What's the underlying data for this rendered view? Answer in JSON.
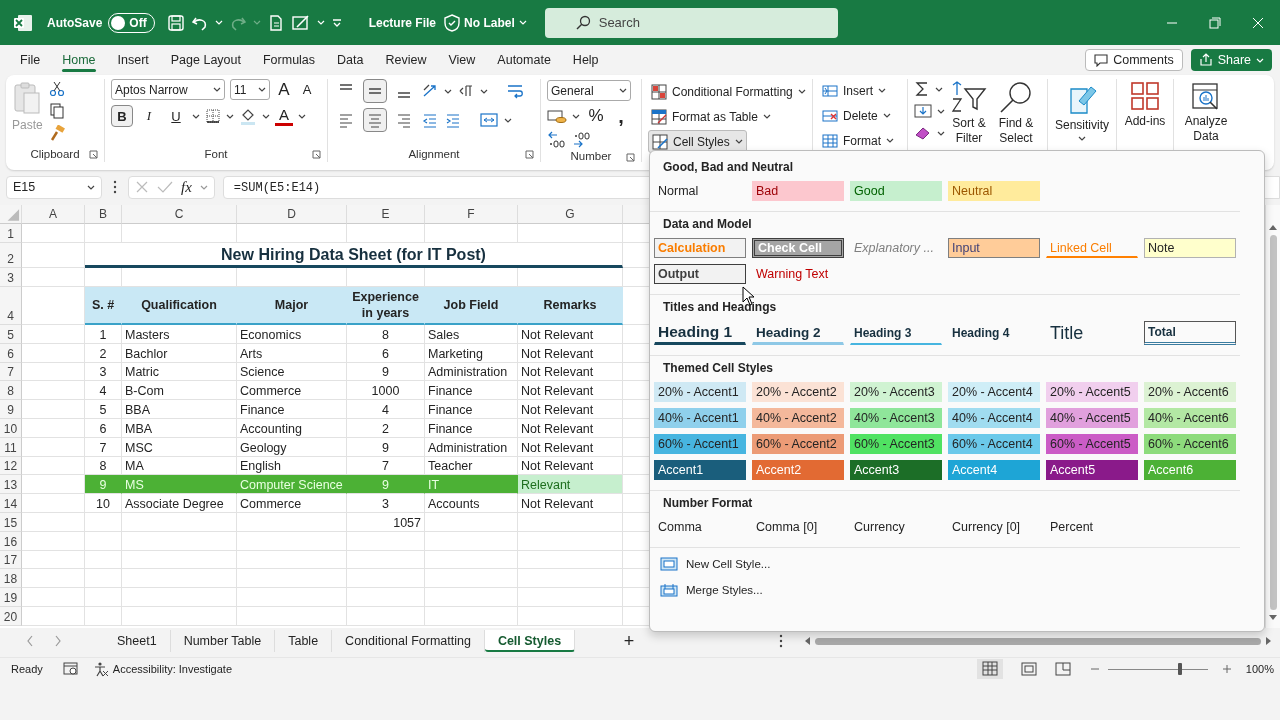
{
  "titlebar": {
    "autosave_label": "AutoSave",
    "autosave": {
      "label": "Off",
      "on": false
    },
    "file_name": "Lecture File",
    "label_button": "No Label",
    "search": {
      "placeholder": "Search"
    }
  },
  "menu": {
    "tabs": [
      {
        "label": "File",
        "selected": false
      },
      {
        "label": "Home",
        "selected": true
      },
      {
        "label": "Insert",
        "selected": false
      },
      {
        "label": "Page Layout",
        "selected": false
      },
      {
        "label": "Formulas",
        "selected": false
      },
      {
        "label": "Data",
        "selected": false
      },
      {
        "label": "Review",
        "selected": false
      },
      {
        "label": "View",
        "selected": false
      },
      {
        "label": "Automate",
        "selected": false
      },
      {
        "label": "Help",
        "selected": false
      }
    ],
    "comments": "Comments",
    "share": "Share"
  },
  "ribbon": {
    "clipboard": {
      "paste": "Paste",
      "label": "Clipboard"
    },
    "font": {
      "name": "Aptos Narrow",
      "size": "11",
      "grow": "A",
      "shrink": "A",
      "styles": [
        {
          "label": "B",
          "selected": true
        },
        {
          "label": "I",
          "selected": false
        },
        {
          "label": "U",
          "selected": false
        }
      ],
      "color_button": "A",
      "label": "Font"
    },
    "alignment": {
      "vertical": [
        {
          "selected": false
        },
        {
          "selected": true
        },
        {
          "selected": false
        }
      ],
      "horizontal": [
        {
          "selected": false
        },
        {
          "selected": true
        },
        {
          "selected": false
        }
      ],
      "label": "Alignment"
    },
    "number": {
      "format": "General",
      "percent": "%",
      "comma": ",",
      "label": "Number"
    },
    "styles": [
      {
        "label": "Conditional Formatting",
        "expanded": false
      },
      {
        "label": "Format as Table",
        "expanded": false
      },
      {
        "label": "Cell Styles",
        "expanded": true
      }
    ],
    "cells": [
      "Insert",
      "Delete",
      "Format"
    ],
    "editing": [
      "Sort & Filter",
      "Find & Select"
    ],
    "sensitivity": "Sensitivity",
    "add_ins": "Add-ins",
    "analyze": "Analyze Data"
  },
  "formula_bar": {
    "name_box": "E15",
    "function_label": "fx",
    "formula": "=SUM(E5:E14)"
  },
  "sheet": {
    "columns": [
      "A",
      "B",
      "C",
      "D",
      "E",
      "F",
      "G"
    ],
    "rows": [
      {
        "number": "1",
        "kind": "blank"
      },
      {
        "number": "2",
        "kind": "title",
        "title": "New Hiring Data Sheet (for IT Post)"
      },
      {
        "number": "3",
        "kind": "blank"
      },
      {
        "number": "4",
        "kind": "header",
        "cells": [
          "S. #",
          "Qualification",
          "Major",
          "Experience in years",
          "Job Field",
          "Remarks"
        ]
      },
      {
        "number": "5",
        "kind": "data",
        "highlighted": false,
        "cells": [
          "1",
          "Masters",
          "Economics",
          "8",
          "Sales",
          "Not Relevant"
        ]
      },
      {
        "number": "6",
        "kind": "data",
        "highlighted": false,
        "cells": [
          "2",
          "Bachlor",
          "Arts",
          "6",
          "Marketing",
          "Not Relevant"
        ]
      },
      {
        "number": "7",
        "kind": "data",
        "highlighted": false,
        "cells": [
          "3",
          "Matric",
          "Science",
          "9",
          "Administration",
          "Not Relevant"
        ]
      },
      {
        "number": "8",
        "kind": "data",
        "highlighted": false,
        "cells": [
          "4",
          "B-Com",
          "Commerce",
          "1000",
          "Finance",
          "Not Relevant"
        ]
      },
      {
        "number": "9",
        "kind": "data",
        "highlighted": false,
        "cells": [
          "5",
          "BBA",
          "Finance",
          "4",
          "Finance",
          "Not Relevant"
        ]
      },
      {
        "number": "10",
        "kind": "data",
        "highlighted": false,
        "cells": [
          "6",
          "MBA",
          "Accounting",
          "2",
          "Finance",
          "Not Relevant"
        ]
      },
      {
        "number": "11",
        "kind": "data",
        "highlighted": false,
        "cells": [
          "7",
          "MSC",
          "Geology",
          "9",
          "Administration",
          "Not Relevant"
        ]
      },
      {
        "number": "12",
        "kind": "data",
        "highlighted": false,
        "cells": [
          "8",
          "MA",
          "English",
          "7",
          "Teacher",
          "Not Relevant"
        ]
      },
      {
        "number": "13",
        "kind": "data",
        "highlighted": true,
        "cells": [
          "9",
          "MS",
          "Computer Science",
          "9",
          "IT",
          "Relevant"
        ]
      },
      {
        "number": "14",
        "kind": "data",
        "highlighted": false,
        "cells": [
          "10",
          "Associate Degree",
          "Commerce",
          "3",
          "Accounts",
          "Not Relevant"
        ]
      },
      {
        "number": "15",
        "kind": "total",
        "total": "1057"
      },
      {
        "number": "16",
        "kind": "blank"
      },
      {
        "number": "17",
        "kind": "blank"
      },
      {
        "number": "18",
        "kind": "blank"
      },
      {
        "number": "19",
        "kind": "blank"
      },
      {
        "number": "20",
        "kind": "blank"
      }
    ]
  },
  "cell_styles_menu": {
    "sections": [
      {
        "title": "Good, Bad and Neutral",
        "styles": [
          {
            "label": "Normal",
            "kind": "normal"
          },
          {
            "label": "Bad",
            "kind": "bad"
          },
          {
            "label": "Good",
            "kind": "good"
          },
          {
            "label": "Neutral",
            "kind": "neutral"
          }
        ]
      },
      {
        "title": "Data and Model",
        "styles": [
          {
            "label": "Calculation",
            "kind": "calculation"
          },
          {
            "label": "Check Cell",
            "kind": "check"
          },
          {
            "label": "Explanatory ...",
            "kind": "explanatory"
          },
          {
            "label": "Input",
            "kind": "input"
          },
          {
            "label": "Linked Cell",
            "kind": "linked"
          },
          {
            "label": "Note",
            "kind": "note"
          },
          {
            "label": "Output",
            "kind": "output"
          },
          {
            "label": "Warning Text",
            "kind": "warning"
          }
        ]
      },
      {
        "title": "Titles and Headings",
        "styles": [
          {
            "label": "Heading 1",
            "kind": "h1"
          },
          {
            "label": "Heading 2",
            "kind": "h2"
          },
          {
            "label": "Heading 3",
            "kind": "h3"
          },
          {
            "label": "Heading 4",
            "kind": "h4"
          },
          {
            "label": "Title",
            "kind": "title"
          },
          {
            "label": "Total",
            "kind": "total"
          }
        ]
      },
      {
        "title": "Themed Cell Styles",
        "styles": [
          {
            "label": "20% - Accent1",
            "kind": "tint",
            "color": "#cfe9f4"
          },
          {
            "label": "20% - Accent2",
            "kind": "tint",
            "color": "#fbe2d5"
          },
          {
            "label": "20% - Accent3",
            "kind": "tint",
            "color": "#d0f3d2"
          },
          {
            "label": "20% - Accent4",
            "kind": "tint",
            "color": "#cfeef7"
          },
          {
            "label": "20% - Accent5",
            "kind": "tint",
            "color": "#f1cfee"
          },
          {
            "label": "20% - Accent6",
            "kind": "tint",
            "color": "#dcf2d3"
          },
          {
            "label": "40% - Accent1",
            "kind": "tint",
            "color": "#8fd0ec"
          },
          {
            "label": "40% - Accent2",
            "kind": "tint",
            "color": "#f4b89b"
          },
          {
            "label": "40% - Accent3",
            "kind": "tint",
            "color": "#8fe69a"
          },
          {
            "label": "40% - Accent4",
            "kind": "tint",
            "color": "#a0dcf0"
          },
          {
            "label": "40% - Accent5",
            "kind": "tint",
            "color": "#e1a0dd"
          },
          {
            "label": "40% - Accent6",
            "kind": "tint",
            "color": "#b3e8a4"
          },
          {
            "label": "60% - Accent1",
            "kind": "tint",
            "color": "#47b5e0"
          },
          {
            "label": "60% - Accent2",
            "kind": "tint",
            "color": "#ec9b76"
          },
          {
            "label": "60% - Accent3",
            "kind": "tint",
            "color": "#50e262"
          },
          {
            "label": "60% - Accent4",
            "kind": "tint",
            "color": "#6bc9ea"
          },
          {
            "label": "60% - Accent5",
            "kind": "tint",
            "color": "#cb5cc6"
          },
          {
            "label": "60% - Accent6",
            "kind": "tint",
            "color": "#8ddb7c"
          },
          {
            "label": "Accent1",
            "kind": "solid",
            "color": "#1a5e7c"
          },
          {
            "label": "Accent2",
            "kind": "solid",
            "color": "#e26a33"
          },
          {
            "label": "Accent3",
            "kind": "solid",
            "color": "#1c6e27"
          },
          {
            "label": "Accent4",
            "kind": "solid",
            "color": "#1ea5d6"
          },
          {
            "label": "Accent5",
            "kind": "solid",
            "color": "#8a1a8a"
          },
          {
            "label": "Accent6",
            "kind": "solid",
            "color": "#4cb135"
          }
        ]
      },
      {
        "title": "Number Format",
        "styles": [
          {
            "label": "Comma",
            "kind": "normal"
          },
          {
            "label": "Comma [0]",
            "kind": "normal"
          },
          {
            "label": "Currency",
            "kind": "normal"
          },
          {
            "label": "Currency [0]",
            "kind": "normal"
          },
          {
            "label": "Percent",
            "kind": "normal"
          }
        ]
      }
    ],
    "commands": [
      {
        "label": "New Cell Style...",
        "kind": "new"
      },
      {
        "label": "Merge Styles...",
        "kind": "merge"
      }
    ]
  },
  "sheet_tabs": [
    {
      "label": "Sheet1",
      "selected": false
    },
    {
      "label": "Number Table",
      "selected": false
    },
    {
      "label": "Table",
      "selected": false
    },
    {
      "label": "Conditional Formatting",
      "selected": false
    },
    {
      "label": "Cell Styles",
      "selected": true
    }
  ],
  "new_sheet": "+",
  "status_bar": {
    "status": "Ready",
    "accessibility": "Accessibility: Investigate",
    "zoom": {
      "level": 0.72
    },
    "zoom_label": "100%"
  }
}
